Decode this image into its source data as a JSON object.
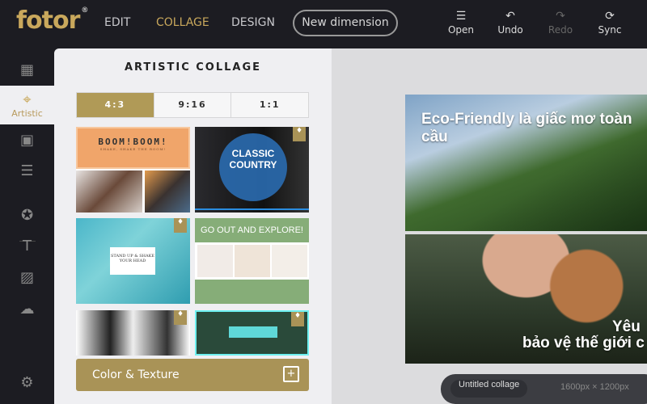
{
  "header": {
    "logo": "fotor",
    "nav": [
      "EDIT",
      "COLLAGE",
      "DESIGN"
    ],
    "active_nav": "COLLAGE",
    "new_dimension": "New dimension",
    "tools": [
      {
        "label": "Open",
        "icon": "menu-icon"
      },
      {
        "label": "Undo",
        "icon": "undo-icon"
      },
      {
        "label": "Redo",
        "icon": "redo-icon",
        "disabled": true
      },
      {
        "label": "Sync",
        "icon": "sync-icon"
      }
    ]
  },
  "sidebar": {
    "active_label": "Artistic"
  },
  "panel": {
    "title": "ARTISTIC COLLAGE",
    "ratios": [
      "4:3",
      "9:16",
      "1:1"
    ],
    "active_ratio": "4:3",
    "templates": [
      {
        "title": "BOOM!BOOM!",
        "subtitle": "SHAKE, SHAKE THE ROOM!"
      },
      {
        "title": "CLASSIC COUNTRY",
        "premium": true
      },
      {
        "title": "STAND UP & SHAKE YOUR HEAD",
        "premium": true
      },
      {
        "title": "GO OUT AND EXPLORE!"
      },
      {
        "title": "",
        "premium": true
      },
      {
        "title": "",
        "premium": true
      }
    ],
    "color_texture": "Color & Texture"
  },
  "canvas": {
    "caption1": "Eco-Friendly là giấc mơ toàn cầu",
    "caption2a": "Yêu",
    "caption2b": "bảo vệ thế giới c",
    "name": "Untitled collage",
    "size": "1600px × 1200px"
  },
  "colors": {
    "accent": "#c9a85c",
    "button": "#a99357",
    "topbar": "#1c1c22"
  }
}
